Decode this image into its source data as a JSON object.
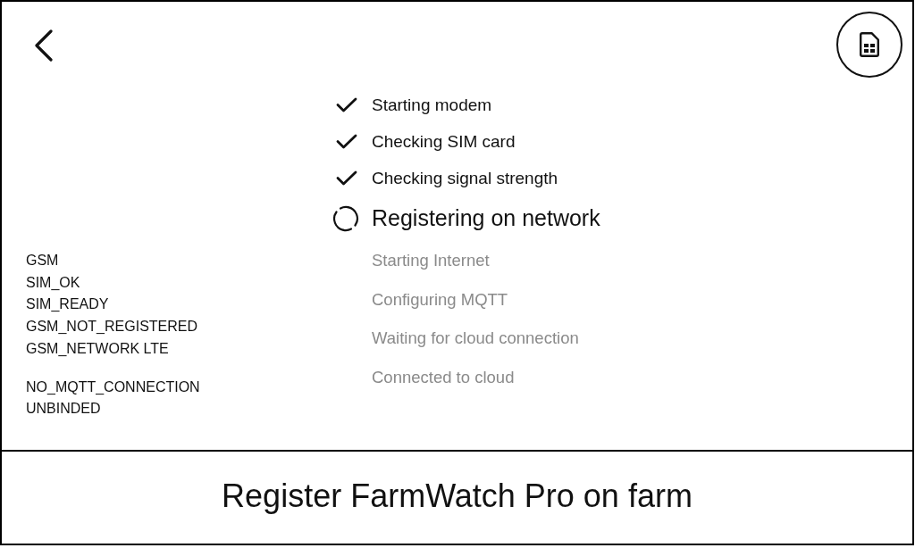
{
  "status_groups": [
    {
      "lines": [
        "GSM",
        "SIM_OK",
        "SIM_READY",
        "GSM_NOT_REGISTERED",
        "GSM_NETWORK LTE"
      ]
    },
    {
      "lines": [
        "NO_MQTT_CONNECTION",
        "UNBINDED"
      ]
    }
  ],
  "steps": [
    {
      "label": "Starting modem",
      "kind": "done"
    },
    {
      "label": "Checking SIM card",
      "kind": "done"
    },
    {
      "label": "Checking signal strength",
      "kind": "done"
    },
    {
      "label": "Registering on network",
      "kind": "active"
    },
    {
      "label": "Starting Internet",
      "kind": "pending"
    },
    {
      "label": "Configuring MQTT",
      "kind": "pending"
    },
    {
      "label": "Waiting for cloud connection",
      "kind": "pending"
    },
    {
      "label": "Connected to cloud",
      "kind": "pending"
    }
  ],
  "register_button": {
    "label": "Register FarmWatch Pro on farm"
  }
}
